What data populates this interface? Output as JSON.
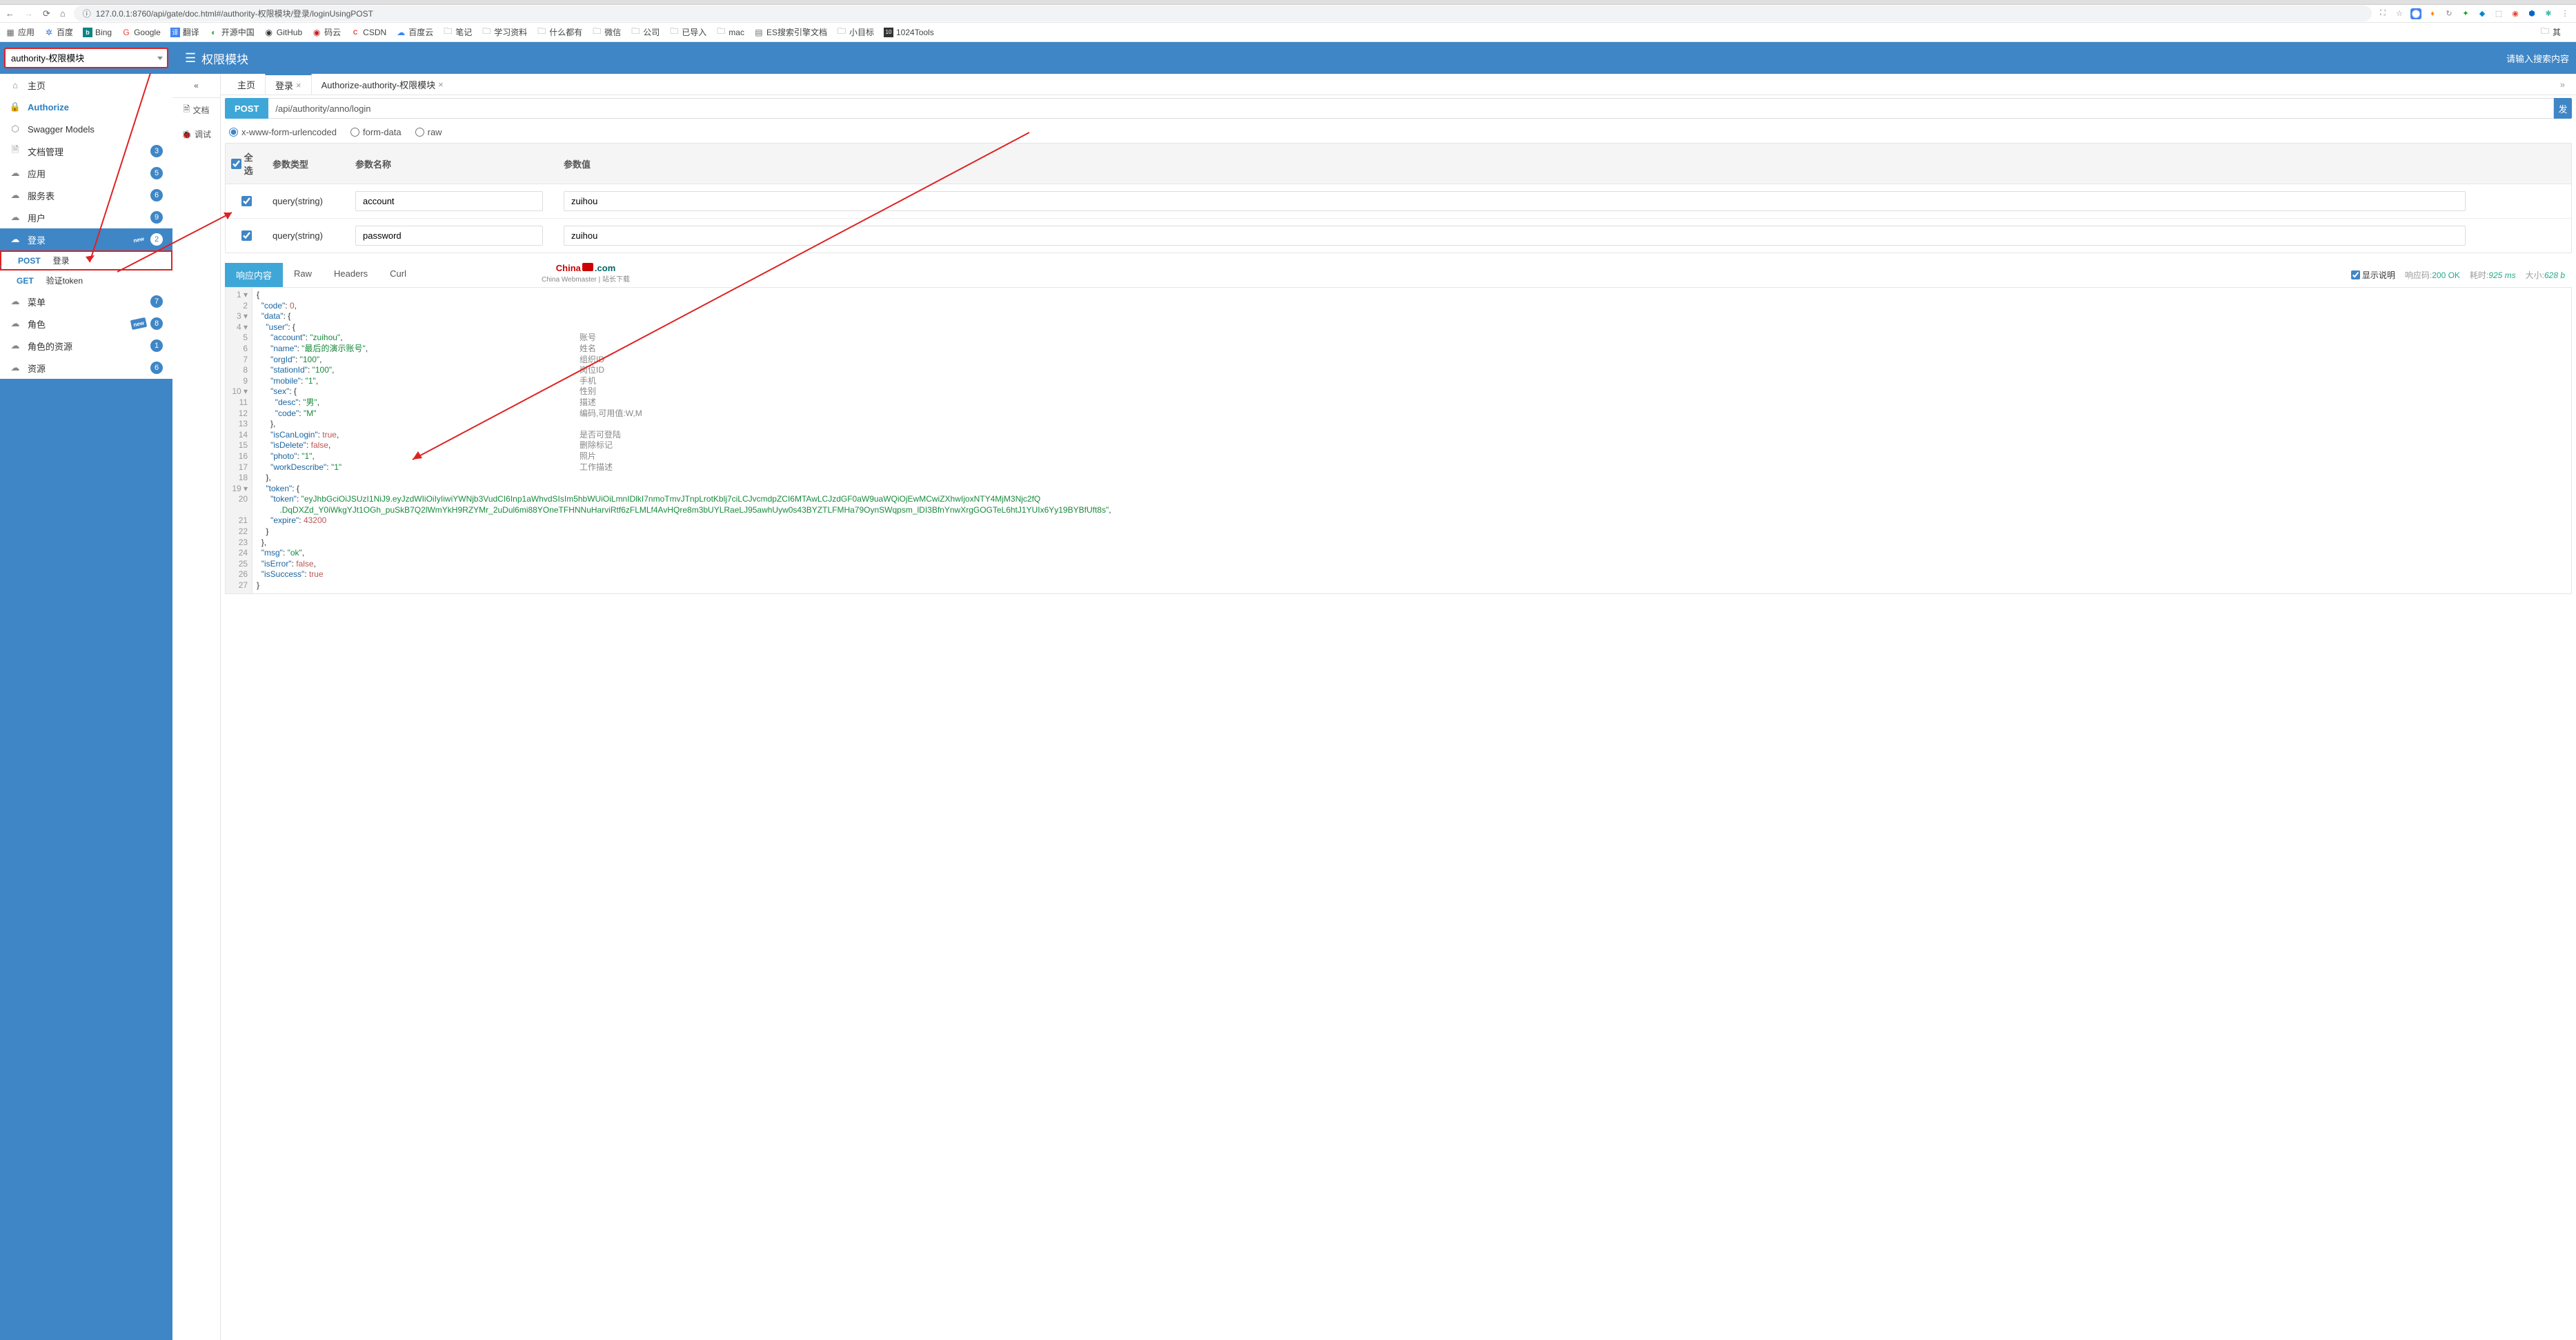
{
  "browser": {
    "url": "127.0.0.1:8760/api/gate/doc.html#/authority-权限模块/登录/loginUsingPOST",
    "bookmarks": {
      "apps": "应用",
      "baidu": "百度",
      "bing": "Bing",
      "google": "Google",
      "trans": "翻译",
      "oschina": "开源中国",
      "github": "GitHub",
      "gitee": "码云",
      "csdn": "CSDN",
      "baiducloud": "百度云",
      "notes": "笔记",
      "study": "学习资料",
      "stuff": "什么都有",
      "wechat": "微信",
      "company": "公司",
      "imported": "已导入",
      "mac": "mac",
      "es": "ES搜索引擎文档",
      "goal": "小目标",
      "tools": "1024Tools",
      "other": "其"
    }
  },
  "header": {
    "selector": "authority-权限模块",
    "title": "权限模块",
    "search_placeholder": "请输入搜索内容"
  },
  "sidebar": {
    "home": "主页",
    "authorize": "Authorize",
    "swagger": "Swagger Models",
    "doc": "文档管理",
    "doc_badge": "3",
    "app": "应用",
    "app_badge": "5",
    "service": "服务表",
    "service_badge": "6",
    "user": "用户",
    "user_badge": "9",
    "login": "登录",
    "login_badge": "2",
    "login_post": "POST",
    "login_post_label": "登录",
    "login_get": "GET",
    "login_get_label": "验证token",
    "menu": "菜单",
    "menu_badge": "7",
    "role": "角色",
    "role_badge": "8",
    "roleres": "角色的资源",
    "roleres_badge": "1",
    "res": "资源",
    "res_badge": "6"
  },
  "mid": {
    "doc": "文档",
    "debug": "调试"
  },
  "tabs": {
    "home": "主页",
    "login": "登录",
    "auth": "Authorize-authority-权限模块"
  },
  "req": {
    "method": "POST",
    "url": "/api/authority/anno/login",
    "send": "发",
    "body_xwww": "x-www-form-urlencoded",
    "body_form": "form-data",
    "body_raw": "raw"
  },
  "params": {
    "all": "全选",
    "type": "参数类型",
    "name": "参数名称",
    "value": "参数值",
    "rows": [
      {
        "type": "query(string)",
        "name": "account",
        "value": "zuihou"
      },
      {
        "type": "query(string)",
        "name": "password",
        "value": "zuihou"
      }
    ]
  },
  "resp": {
    "tab_body": "响应内容",
    "tab_raw": "Raw",
    "tab_headers": "Headers",
    "tab_curl": "Curl",
    "wm1a": "China",
    "wm1b": ".com",
    "wm2": "China Webmaster | 站长下载",
    "show_desc": "显示说明",
    "code_k": "响应码:",
    "code_v": "200 OK",
    "time_k": "耗时:",
    "time_v": "925 ms",
    "size_k": "大小:",
    "size_v": "628 b"
  },
  "json_gutter": "  1 ▾\n  2\n  3 ▾\n  4 ▾\n  5\n  6\n  7\n  8\n  9\n 10 ▾\n 11\n 12\n 13\n 14\n 15\n 16\n 17\n 18\n 19 ▾\n 20\n\n 21\n 22\n 23\n 24\n 25\n 26\n 27",
  "ann": {
    "a5": "账号",
    "a6": "姓名",
    "a7": "组织ID",
    "a8": "岗位ID",
    "a9": "手机",
    "a10": "性别",
    "a11": "描述",
    "a12": "编码,可用值:W,M",
    "a14": "是否可登陆",
    "a15": "删除标记",
    "a16": "照片",
    "a17": "工作描述"
  },
  "code_lines": {
    "l1": "{",
    "l2": "  \"code\": 0,",
    "l3": "  \"data\": {",
    "l4": "    \"user\": {",
    "l5": "      \"account\": \"zuihou\",",
    "l6": "      \"name\": \"最后的演示账号\",",
    "l7": "      \"orgId\": \"100\",",
    "l8": "      \"stationId\": \"100\",",
    "l9": "      \"mobile\": \"1\",",
    "l10": "      \"sex\": {",
    "l11": "        \"desc\": \"男\",",
    "l12": "        \"code\": \"M\"",
    "l13": "      },",
    "l14": "      \"isCanLogin\": true,",
    "l15": "      \"isDelete\": false,",
    "l16": "      \"photo\": \"1\",",
    "l17": "      \"workDescribe\": \"1\"",
    "l18": "    },",
    "l19": "    \"token\": {",
    "l20": "      \"token\": \"eyJhbGciOiJSUzI1NiJ9.eyJzdWIiOiIyIiwiYWNjb3VudCI6Inp1aWhvdSIsIm5hbWUiOiLmnIDlkI7nmoTmvJTnpLrotKblj7ciLCJvcmdpZCI6MTAwLCJzdGF0aW9uaWQiOjEwMCwiZXhwIjoxNTY4MjM3Njc2fQ\n          .DqDXZd_Y0iWkgYJt1OGh_puSkB7Q2lWmYkH9RZYMr_2uDul6mi88YOneTFHNNuHarviRtf6zFLMLf4AvHQre8m3bUYLRaeLJ95awhUyw0s43BYZTLFMHa79OynSWqpsm_lDI3BfnYnwXrgGOGTeL6htJ1YUIx6Yy19BYBfUft8s\",",
    "l21": "      \"expire\": 43200",
    "l22": "    }",
    "l23": "  },",
    "l24": "  \"msg\": \"ok\",",
    "l25": "  \"isError\": false,",
    "l26": "  \"isSuccess\": true",
    "l27": "}"
  }
}
